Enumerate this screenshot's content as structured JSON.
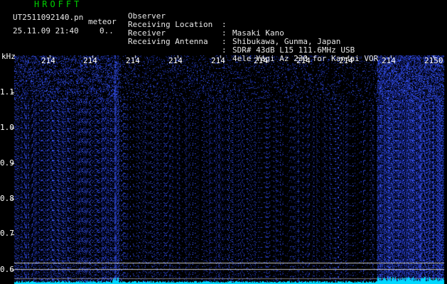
{
  "header": {
    "app_title": "HROFFT",
    "file_name": "UT2511092140.pn",
    "mode": "meteor",
    "timestamp": "25.11.09 21:40",
    "count": "0.."
  },
  "meta": [
    {
      "label": "Observer",
      "value": "Masaki Kano"
    },
    {
      "label": "Receiving Location",
      "value": "Shibukawa, Gunma, Japan"
    },
    {
      "label": "Receiver",
      "value": "SDR# 43dB L15 111.6MHz USB"
    },
    {
      "label": "Receiving Antenna",
      "value": "4ele Yagi Az 230 for Kansai VOR"
    }
  ],
  "separator": ":",
  "waterfall": {
    "unit_label": "kHz",
    "time_ticks": [
      "214",
      "214",
      "214",
      "214",
      "214",
      "214",
      "214",
      "214",
      "214",
      "2150"
    ],
    "freq_ticks": [
      "1.1",
      "1.0",
      "0.9",
      "0.8",
      "0.7",
      "0.6"
    ],
    "colors": {
      "background": "#000000",
      "noise": "#1a2a9a",
      "noise_bright": "#3a5aff",
      "signal_line": "#c8c8c8",
      "spectrum": "#00d8ff",
      "tick_text": "#ffffff",
      "title_green": "#00d000"
    }
  }
}
